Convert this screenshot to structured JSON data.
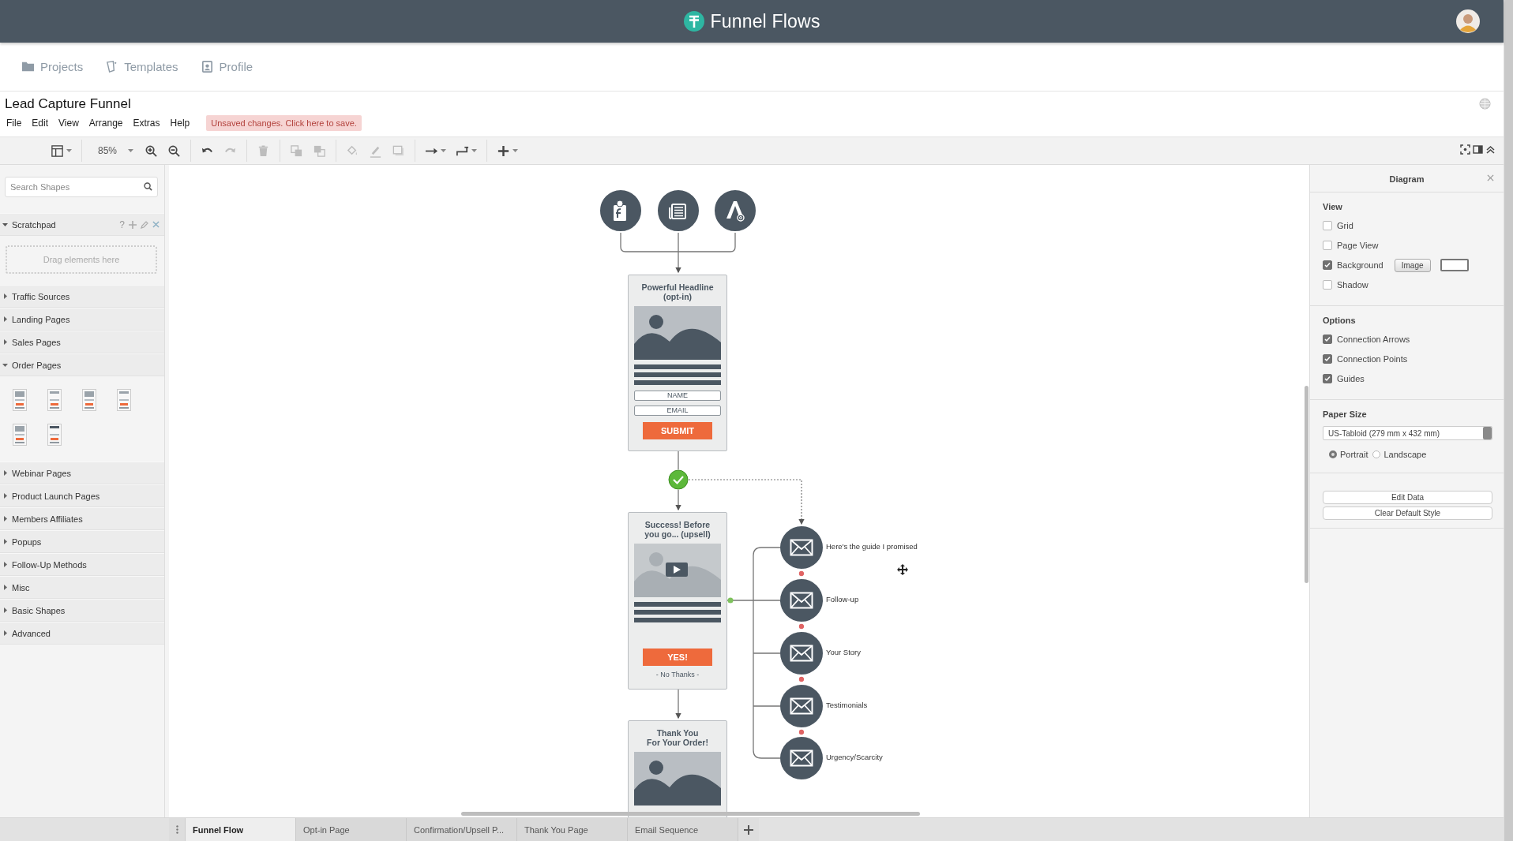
{
  "header": {
    "title": "Funnel Flows"
  },
  "nav": [
    {
      "label": "Projects"
    },
    {
      "label": "Templates"
    },
    {
      "label": "Profile"
    }
  ],
  "document": {
    "title": "Lead Capture Funnel",
    "menu": [
      "File",
      "Edit",
      "View",
      "Arrange",
      "Extras",
      "Help"
    ],
    "save_notice": "Unsaved changes. Click here to save."
  },
  "toolbar": {
    "zoom": "85%",
    "tools": [
      {
        "kind": "panel",
        "disabled": false
      },
      {
        "kind": "zoom_in",
        "disabled": false
      },
      {
        "kind": "zoom_out",
        "disabled": false
      },
      {
        "kind": "undo",
        "disabled": false
      },
      {
        "kind": "redo",
        "disabled": true
      },
      {
        "kind": "delete",
        "disabled": true
      },
      {
        "kind": "to_front",
        "disabled": true
      },
      {
        "kind": "to_back",
        "disabled": true
      },
      {
        "kind": "fill",
        "disabled": true
      },
      {
        "kind": "line",
        "disabled": true
      },
      {
        "kind": "shadow",
        "disabled": true
      },
      {
        "kind": "connector",
        "disabled": false
      },
      {
        "kind": "waypoint",
        "disabled": false
      },
      {
        "kind": "insert",
        "disabled": false
      }
    ]
  },
  "sidebar": {
    "search": {
      "placeholder": "Search Shapes"
    },
    "scratchpad": {
      "title": "Scratchpad",
      "expanded": true,
      "help": "?",
      "hint": "Drag elements here"
    },
    "categories": [
      {
        "label": "Traffic Sources",
        "expanded": false
      },
      {
        "label": "Landing Pages",
        "expanded": false
      },
      {
        "label": "Sales Pages",
        "expanded": false
      },
      {
        "label": "Order Pages",
        "expanded": true
      },
      {
        "label": "Webinar Pages",
        "expanded": false
      },
      {
        "label": "Product Launch Pages",
        "expanded": false
      },
      {
        "label": "Members Affiliates",
        "expanded": false
      },
      {
        "label": "Popups",
        "expanded": false
      },
      {
        "label": "Follow-Up Methods",
        "expanded": false
      },
      {
        "label": "Misc",
        "expanded": false
      },
      {
        "label": "Basic Shapes",
        "expanded": false
      },
      {
        "label": "Advanced",
        "expanded": false
      }
    ]
  },
  "diagram": {
    "pages": [
      {
        "kind": "optin",
        "title": "Powerful Headline\n(opt-in)",
        "fields": [
          "NAME",
          "EMAIL"
        ],
        "button": "SUBMIT"
      },
      {
        "kind": "upsell",
        "title": "Success! Before\nyou go... (upsell)",
        "button": "YES!",
        "decline": "- No Thanks -"
      },
      {
        "kind": "thankyou",
        "title": "Thank You\nFor Your Order!"
      }
    ],
    "emails": [
      "Here's the guide I promised",
      "Follow-up",
      "Your Story",
      "Testimonials",
      "Urgency/Scarcity"
    ]
  },
  "panel": {
    "title": "Diagram",
    "sections": [
      {
        "title": "View",
        "options": [
          {
            "label": "Grid",
            "checked": false
          },
          {
            "label": "Page View",
            "checked": false
          },
          {
            "label": "Background",
            "checked": true,
            "button": "Image"
          },
          {
            "label": "Shadow",
            "checked": false
          }
        ]
      },
      {
        "title": "Options",
        "options": [
          {
            "label": "Connection Arrows",
            "checked": true
          },
          {
            "label": "Connection Points",
            "checked": true
          },
          {
            "label": "Guides",
            "checked": true
          }
        ]
      }
    ],
    "paper": {
      "title": "Paper Size",
      "value": "US-Tabloid (279 mm x 432 mm)",
      "orientations": [
        {
          "label": "Portrait",
          "selected": true
        },
        {
          "label": "Landscape",
          "selected": false
        }
      ]
    },
    "actions": [
      "Edit Data",
      "Clear Default Style"
    ]
  },
  "page_tabs": [
    {
      "label": "Funnel Flow",
      "selected": true
    },
    {
      "label": "Opt-in Page",
      "selected": false
    },
    {
      "label": "Confirmation/Upsell P...",
      "selected": false
    },
    {
      "label": "Thank You Page",
      "selected": false
    },
    {
      "label": "Email Sequence",
      "selected": false
    }
  ]
}
